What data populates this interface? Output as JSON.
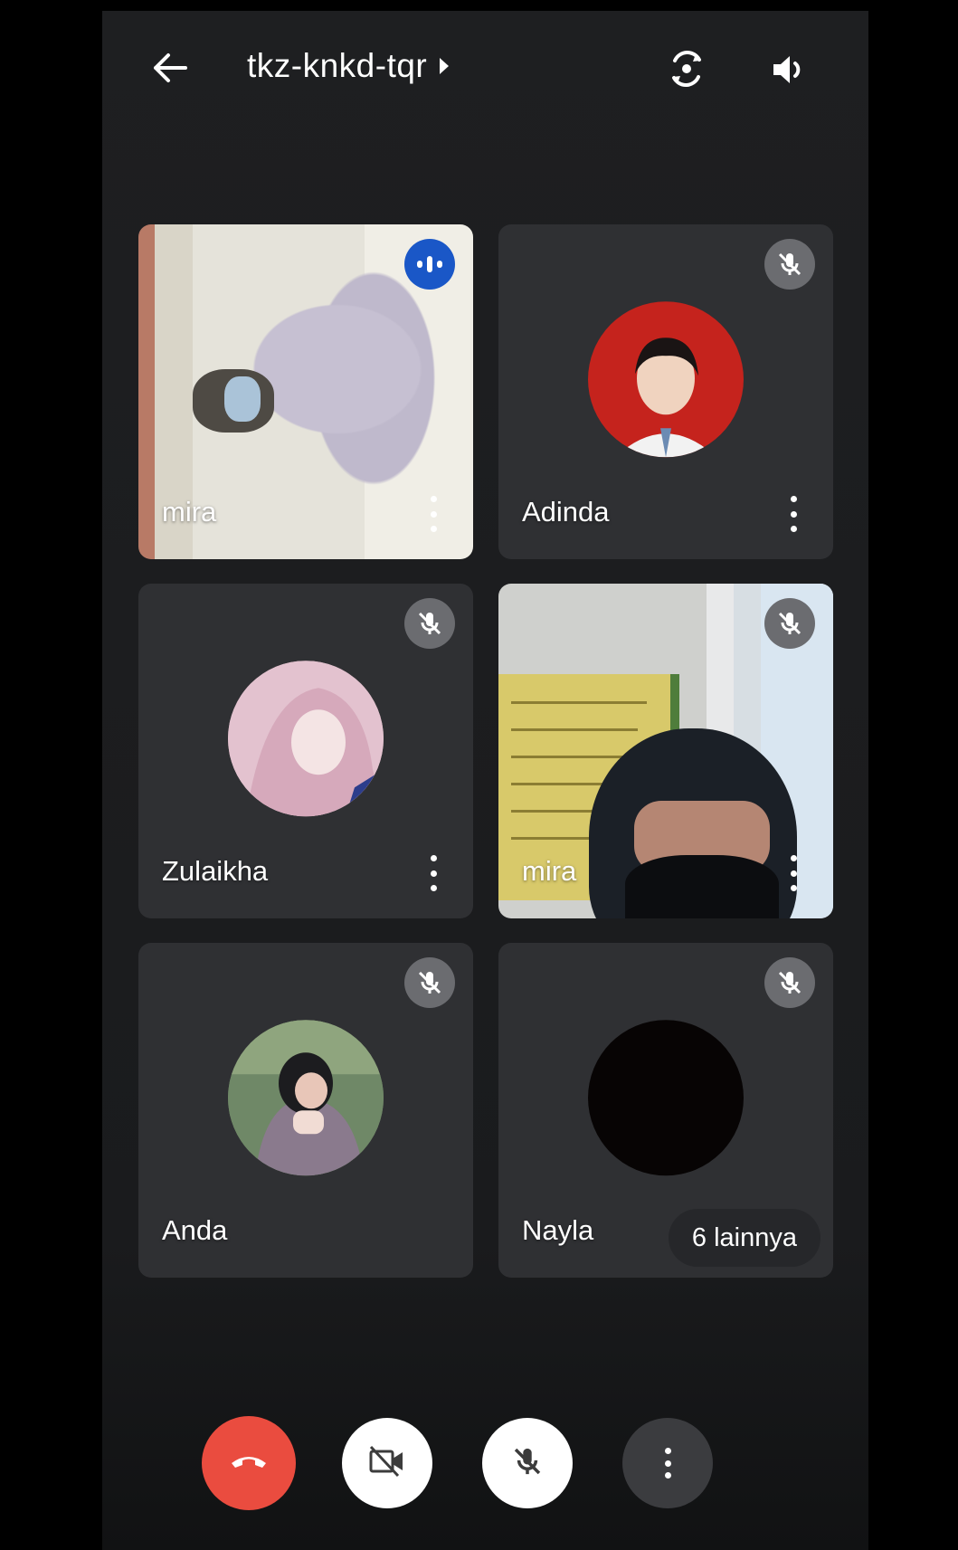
{
  "header": {
    "meeting_code": "tkz-knkd-tqr",
    "icons": [
      "back-arrow-icon",
      "switch-camera-icon",
      "speaker-icon"
    ]
  },
  "participants": [
    {
      "name": "mira",
      "status": "speaking",
      "view": "video"
    },
    {
      "name": "Adinda",
      "status": "muted",
      "view": "avatar"
    },
    {
      "name": "Zulaikha",
      "status": "muted",
      "view": "avatar"
    },
    {
      "name": "mira",
      "status": "muted",
      "view": "video"
    },
    {
      "name": "Anda",
      "status": "muted",
      "view": "avatar"
    },
    {
      "name": "Nayla",
      "status": "muted",
      "view": "avatar"
    }
  ],
  "overflow": {
    "label": "6 lainnya"
  },
  "controls": [
    "end-call-icon",
    "camera-off-icon",
    "mic-off-icon",
    "more-options-icon"
  ],
  "colors": {
    "background": "#1e1f21",
    "tile": "#2f3033",
    "end_call": "#ea4c3f",
    "speaking": "#1a57c7",
    "muted_badge": "#6b6c70"
  }
}
